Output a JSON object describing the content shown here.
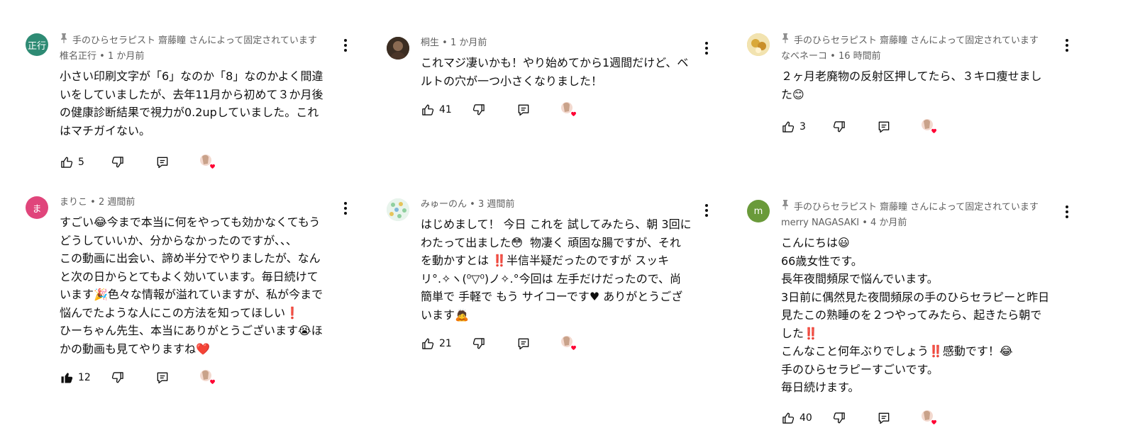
{
  "comments": [
    {
      "avatar_text": "正行",
      "avatar_color": "#2e8b74",
      "pinned_text": "手のひらセラピスト 齋藤瞳 さんによって固定されています",
      "author": "椎名正行",
      "time": "1 か月前",
      "lines": [
        "小さい印刷文字が「6」なのか「8」なのかよく間違",
        "いをしていましたが、去年11月から初めて３か月後",
        "の健康診断結果で視力が0.2upしていました。これ",
        "はマチガイない。"
      ],
      "likes": "5",
      "liked": false
    },
    {
      "avatar_text": "",
      "avatar_color": "#5a4a3a",
      "pinned_text": "",
      "author": "桐生",
      "time": "1 か月前",
      "lines": [
        "これマジ凄いかも！やり始めてから1週間だけど、ベ",
        "ルトの穴が一つ小さくなりました！"
      ],
      "likes": "41",
      "liked": false
    },
    {
      "avatar_text": "",
      "avatar_color": "#e6c24a",
      "pinned_text": "手のひらセラピスト 齋藤瞳 さんによって固定されています",
      "author": "なべネーコ",
      "time": "16 時間前",
      "lines": [
        "２ヶ月老廃物の反射区押してたら、３キロ痩せまし",
        "た😊"
      ],
      "likes": "3",
      "liked": false
    },
    {
      "avatar_text": "ま",
      "avatar_color": "#e0457b",
      "pinned_text": "",
      "author": "まりこ",
      "time": "2 週間前",
      "lines": [
        "すごい😂今まで本当に何をやっても効かなくてもう",
        "どうしていいか、分からなかったのですが、、、",
        "この動画に出会い、諦め半分でやりましたが、なん",
        "と次の日からとてもよく効いています。毎日続けて",
        "います🎉色々な情報が溢れていますが、私が今まで",
        "悩んでたような人にこの方法を知ってほしい❗",
        "ひーちゃん先生、本当にありがとうございます😭ほ",
        "かの動画も見てやりますね❤️"
      ],
      "likes": "12",
      "liked": true
    },
    {
      "avatar_text": "",
      "avatar_color": "#cfe6d8",
      "pinned_text": "",
      "author": "みゅーのん",
      "time": "3 週間前",
      "lines": [
        "はじめまして！ 今日 これを 試してみたら、朝 3回に",
        "わたって出ました😳  物凄く 頑固な腸ですが、それ",
        "を動かすとは ‼️半信半疑だったのですが スッキ",
        "リ°.✧ヽ(⁰▽⁰)ノ✧.°今回は 左手だけだったので、尚",
        "簡単で 手軽で もう サイコーです♥ ありがとうござ",
        "います🙇"
      ],
      "likes": "21",
      "liked": false
    },
    {
      "avatar_text": "m",
      "avatar_color": "#6a9a3a",
      "pinned_text": "手のひらセラピスト 齋藤瞳 さんによって固定されています",
      "author": "merry NAGASAKI",
      "time": "4 か月前",
      "lines": [
        "こんにちは😃",
        "66歳女性です。",
        "長年夜間頻尿で悩んでいます。",
        "3日前に偶然見た夜間頻尿の手のひらセラピーと昨日",
        "見たこの熟睡のを２つやってみたら、起きたら朝で",
        "した‼️",
        "こんなこと何年ぶりでしょう‼️感動です！😂",
        "手のひらセラピーすごいです。",
        "毎日続けます。"
      ],
      "likes": "40",
      "liked": false
    }
  ],
  "icons": {
    "pin": "pin-icon",
    "like": "thumbs-up-icon",
    "dislike": "thumbs-down-icon",
    "reply": "reply-icon",
    "more": "more-vert-icon",
    "creator_heart": "creator-heart-icon"
  },
  "colors": {
    "meta": "#606060",
    "heart": "#ff0033"
  }
}
